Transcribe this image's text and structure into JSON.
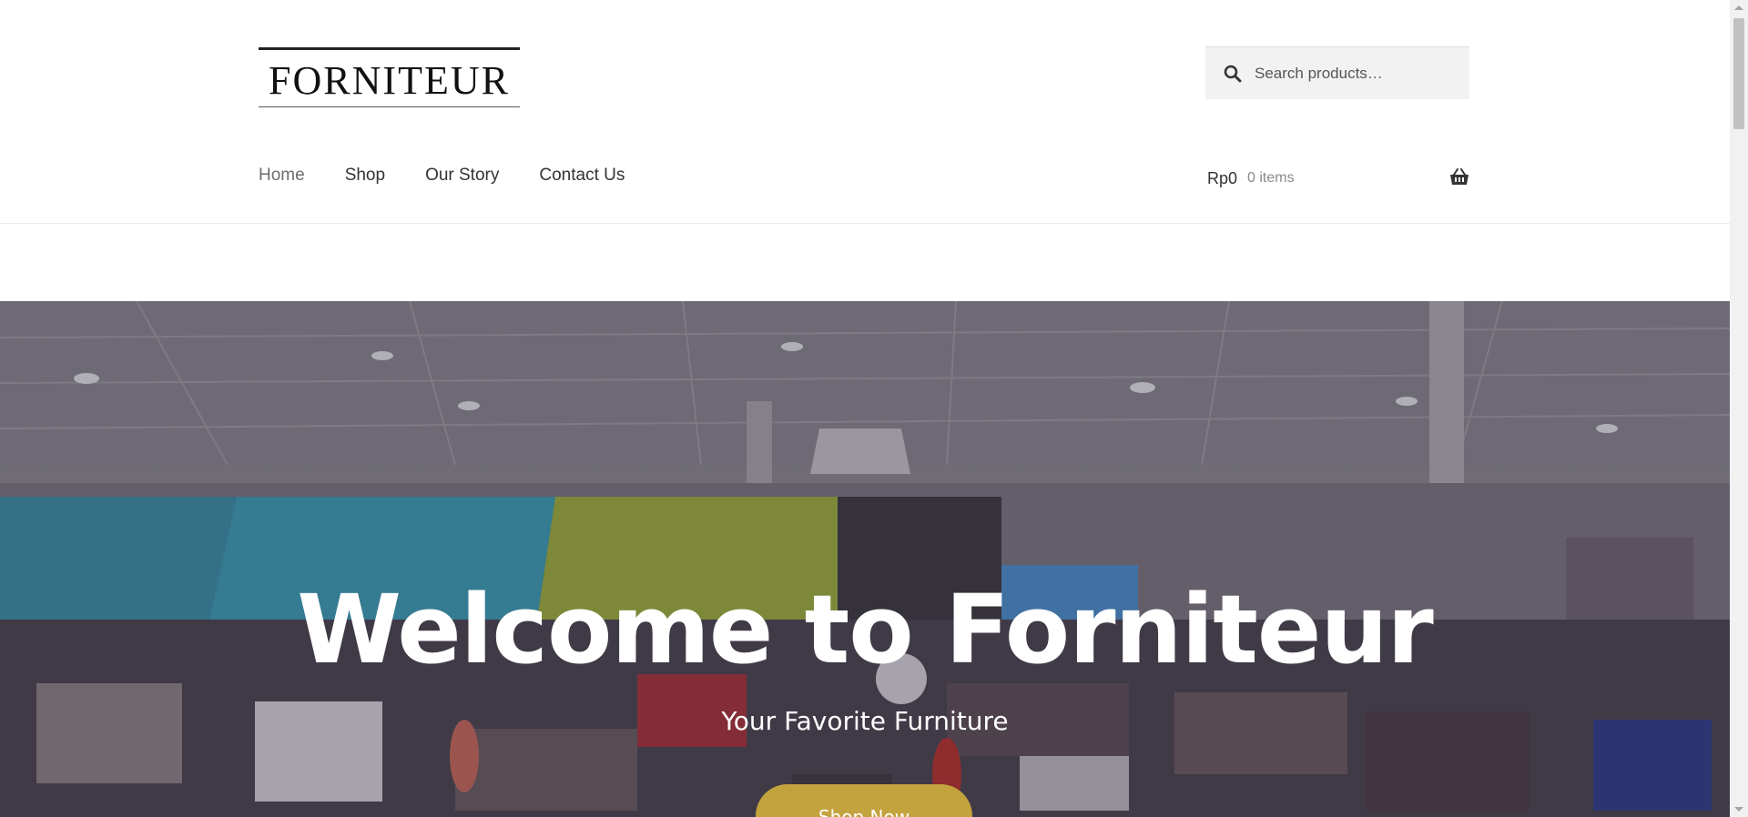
{
  "header": {
    "logo_text": "FORNITEUR",
    "search": {
      "placeholder": "Search products…",
      "icon": "search-icon"
    },
    "nav": [
      {
        "label": "Home",
        "active": true
      },
      {
        "label": "Shop",
        "active": false
      },
      {
        "label": "Our Story",
        "active": false
      },
      {
        "label": "Contact Us",
        "active": false
      }
    ],
    "cart": {
      "amount": "Rp0",
      "count": "0 items",
      "icon": "basket-icon"
    }
  },
  "hero": {
    "title": "Welcome to Forniteur",
    "subtitle": "Your Favorite Furniture",
    "button_label": "Shop Now"
  },
  "colors": {
    "accent": "#c3a33e",
    "text": "#333333",
    "muted": "#8a8a8a"
  }
}
